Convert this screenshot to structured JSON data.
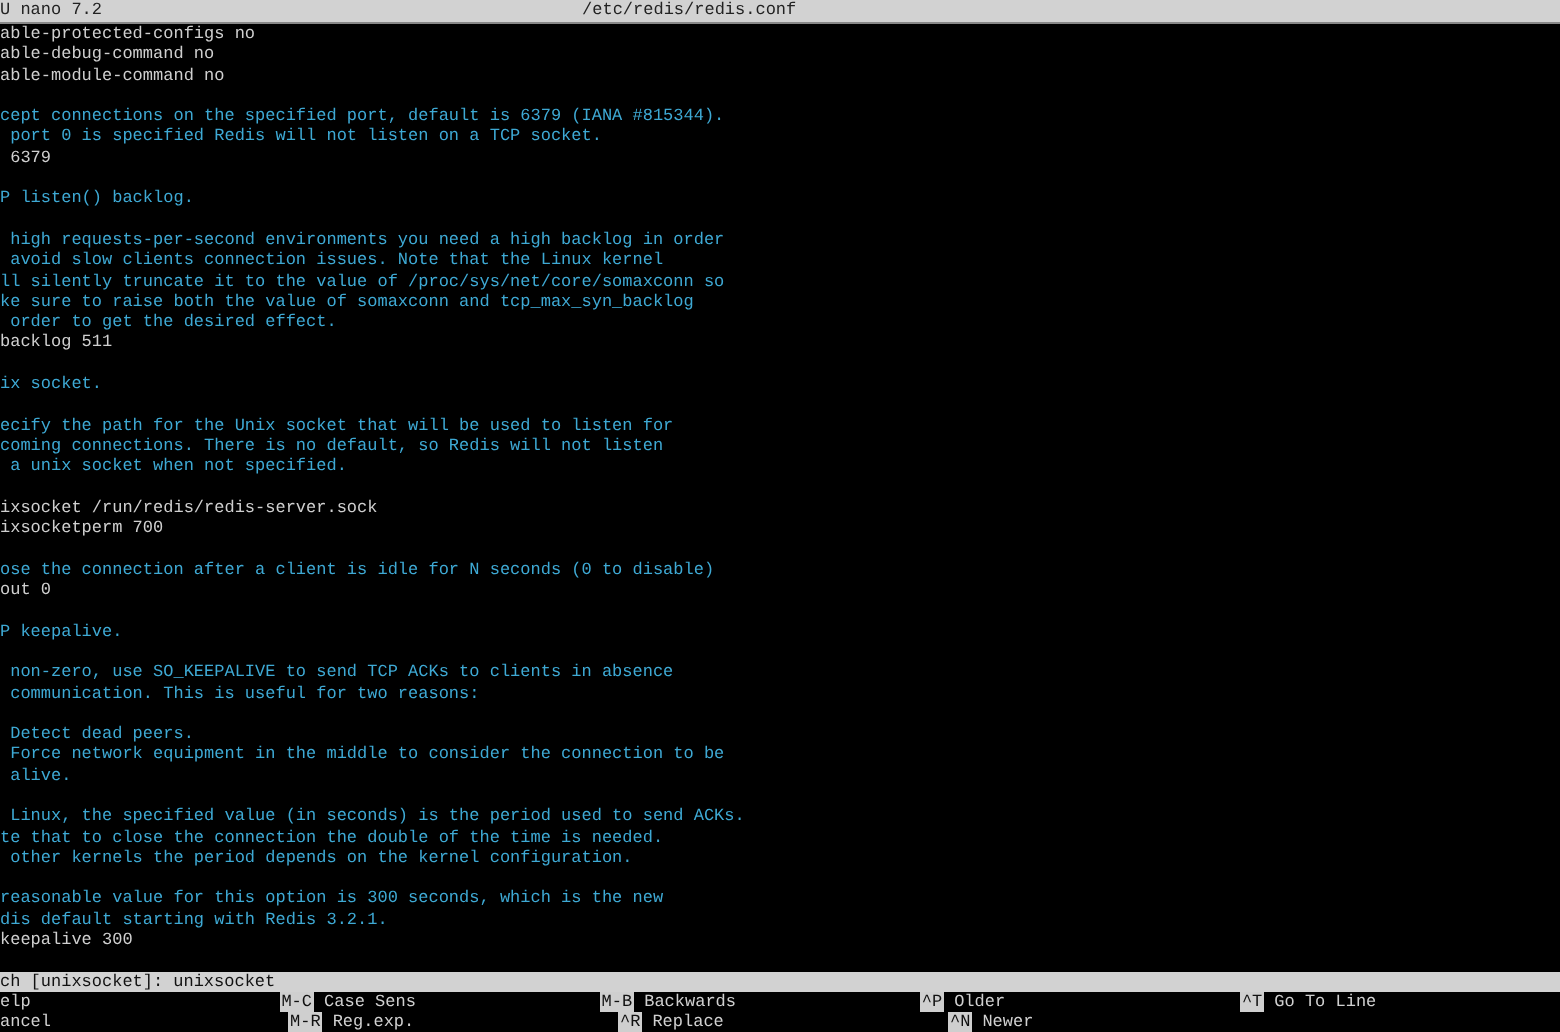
{
  "title_bar": {
    "app": "U nano 7.2",
    "file": "/etc/redis/redis.conf"
  },
  "lines": [
    {
      "kind": "directive",
      "text": "able-protected-configs no"
    },
    {
      "kind": "directive",
      "text": "able-debug-command no"
    },
    {
      "kind": "directive",
      "text": "able-module-command no"
    },
    {
      "kind": "blank"
    },
    {
      "kind": "comment",
      "text": "cept connections on the specified port, default is 6379 (IANA #815344)."
    },
    {
      "kind": "comment",
      "text": " port 0 is specified Redis will not listen on a TCP socket."
    },
    {
      "kind": "directive",
      "text": " 6379"
    },
    {
      "kind": "blank"
    },
    {
      "kind": "comment",
      "text": "P listen() backlog."
    },
    {
      "kind": "blank"
    },
    {
      "kind": "comment",
      "text": " high requests-per-second environments you need a high backlog in order"
    },
    {
      "kind": "comment",
      "text": " avoid slow clients connection issues. Note that the Linux kernel"
    },
    {
      "kind": "comment",
      "text": "ll silently truncate it to the value of /proc/sys/net/core/somaxconn so"
    },
    {
      "kind": "comment",
      "text": "ke sure to raise both the value of somaxconn and tcp_max_syn_backlog"
    },
    {
      "kind": "comment",
      "text": " order to get the desired effect."
    },
    {
      "kind": "directive",
      "text": "backlog 511"
    },
    {
      "kind": "blank"
    },
    {
      "kind": "comment",
      "text": "ix socket."
    },
    {
      "kind": "blank"
    },
    {
      "kind": "comment",
      "text": "ecify the path for the Unix socket that will be used to listen for"
    },
    {
      "kind": "comment",
      "text": "coming connections. There is no default, so Redis will not listen"
    },
    {
      "kind": "comment",
      "text": " a unix socket when not specified."
    },
    {
      "kind": "blank"
    },
    {
      "kind": "directive",
      "text": "ixsocket /run/redis/redis-server.sock"
    },
    {
      "kind": "directive",
      "text": "ixsocketperm 700"
    },
    {
      "kind": "blank"
    },
    {
      "kind": "comment",
      "text": "ose the connection after a client is idle for N seconds (0 to disable)"
    },
    {
      "kind": "directive",
      "text": "out 0"
    },
    {
      "kind": "blank"
    },
    {
      "kind": "comment",
      "text": "P keepalive."
    },
    {
      "kind": "blank"
    },
    {
      "kind": "comment",
      "text": " non-zero, use SO_KEEPALIVE to send TCP ACKs to clients in absence"
    },
    {
      "kind": "comment",
      "text": " communication. This is useful for two reasons:"
    },
    {
      "kind": "blank"
    },
    {
      "kind": "comment",
      "text": " Detect dead peers."
    },
    {
      "kind": "comment",
      "text": " Force network equipment in the middle to consider the connection to be"
    },
    {
      "kind": "comment",
      "text": " alive."
    },
    {
      "kind": "blank"
    },
    {
      "kind": "comment",
      "text": " Linux, the specified value (in seconds) is the period used to send ACKs."
    },
    {
      "kind": "comment",
      "text": "te that to close the connection the double of the time is needed."
    },
    {
      "kind": "comment",
      "text": " other kernels the period depends on the kernel configuration."
    },
    {
      "kind": "blank"
    },
    {
      "kind": "comment",
      "text": "reasonable value for this option is 300 seconds, which is the new"
    },
    {
      "kind": "comment",
      "text": "dis default starting with Redis 3.2.1."
    },
    {
      "kind": "directive",
      "text": "keepalive 300"
    },
    {
      "kind": "blank"
    }
  ],
  "search": {
    "prompt": "ch [unixsocket]:",
    "value": "unixsocket"
  },
  "shortcuts": [
    [
      {
        "label": "elp"
      },
      {
        "key": "M-C",
        "label": "Case Sens"
      },
      {
        "key": "M-B",
        "label": "Backwards"
      },
      {
        "key": "^P",
        "label": "Older"
      },
      {
        "key": "^T",
        "label": "Go To Line"
      }
    ],
    [
      {
        "label": "ancel"
      },
      {
        "key": "M-R",
        "label": "Reg.exp."
      },
      {
        "key": "^R",
        "label": "Replace"
      },
      {
        "key": "^N",
        "label": "Newer"
      }
    ]
  ]
}
